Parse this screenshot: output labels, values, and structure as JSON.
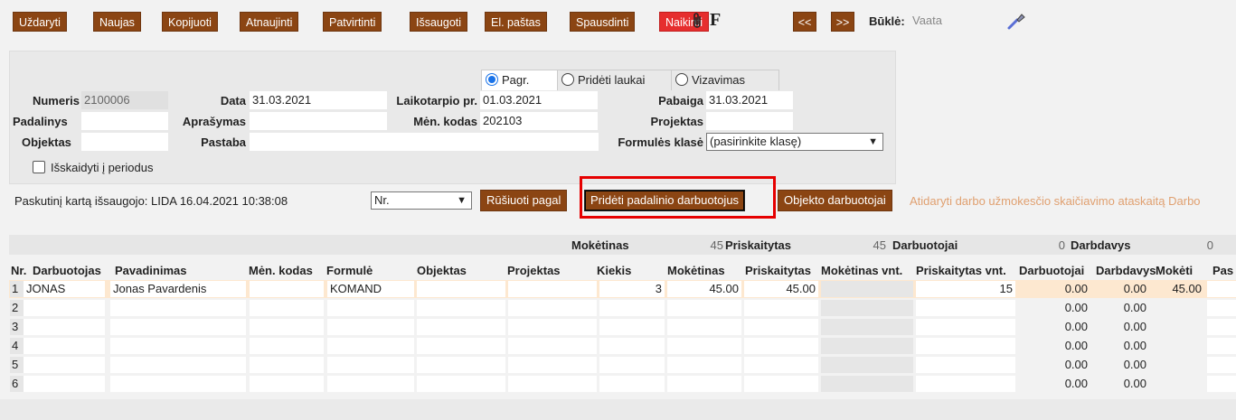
{
  "toolbar": {
    "buttons": [
      "Uždaryti",
      "Naujas",
      "Kopijuoti",
      "Atnaujinti",
      "Patvirtinti",
      "Išsaugoti",
      "El. paštas",
      "Spausdinti",
      "Naikinti"
    ],
    "prev": "<<",
    "next": ">>",
    "f_label": "F",
    "status_label": "Būklė:",
    "status_value": "Vaata"
  },
  "tabs": [
    "Pagr.",
    "Pridėti laukai",
    "Vizavimas"
  ],
  "form": {
    "numeris_label": "Numeris",
    "numeris": "2100006",
    "data_label": "Data",
    "data": "31.03.2021",
    "laikotarpio_label": "Laikotarpio pr.",
    "laikotarpio": "01.03.2021",
    "pabaiga_label": "Pabaiga",
    "pabaiga": "31.03.2021",
    "padalinys_label": "Padalinys",
    "padalinys": "",
    "aprasymas_label": "Aprašymas",
    "aprasymas": "",
    "men_kodas_label": "Mėn. kodas",
    "men_kodas": "202103",
    "projektas_label": "Projektas",
    "projektas": "",
    "objektas_label": "Objektas",
    "objektas": "",
    "pastaba_label": "Pastaba",
    "pastaba": "",
    "formules_klase_label": "Formulės klasė",
    "formules_klase": "(pasirinkite klasę)",
    "isskaidyti_label": "Išskaidyti į periodus"
  },
  "actions": {
    "last_saved": "Paskutinį kartą išsaugojo: LIDA 16.04.2021 10:38:08",
    "sort_select": "Nr.",
    "sort_button": "Rūšiuoti pagal",
    "add_unit_employees": "Pridėti padalinio darbuotojus",
    "object_employees": "Objekto darbuotojai",
    "open_report": "Atidaryti darbo užmokesčio skaičiavimo ataskaitą Darbo"
  },
  "summary": {
    "moketinas_label": "Mokėtinas",
    "moketinas": "45",
    "priskaitytas_label": "Priskaitytas",
    "priskaitytas": "45",
    "darbuotojai_label": "Darbuotojai",
    "darbuotojai": "0",
    "darbdavys_label": "Darbdavys",
    "darbdavys": "0"
  },
  "table": {
    "headers": [
      "Nr.",
      "Darbuotojas",
      "Pavadinimas",
      "Mėn. kodas",
      "Formulė",
      "Objektas",
      "Projektas",
      "Kiekis",
      "Mokėtinas",
      "Priskaitytas",
      "Mokėtinas vnt.",
      "Priskaitytas vnt.",
      "Darbuotojai",
      "Darbdavys",
      "Mokėti",
      "Pas"
    ],
    "rows": [
      {
        "nr": "1",
        "darbuotojas": "JONAS",
        "pavadinimas": "Jonas Pavardenis",
        "men_kodas": "",
        "formule": "KOMAND",
        "objektas": "",
        "projektas": "",
        "kiekis": "3",
        "moketinas": "45.00",
        "priskaitytas": "45.00",
        "moketinas_vnt": "",
        "priskaitytas_vnt": "15",
        "darbuotojai": "0.00",
        "darbdavys": "0.00",
        "moketi": "45.00"
      },
      {
        "nr": "2",
        "darbuotojas": "",
        "pavadinimas": "",
        "men_kodas": "",
        "formule": "",
        "objektas": "",
        "projektas": "",
        "kiekis": "",
        "moketinas": "",
        "priskaitytas": "",
        "moketinas_vnt": "",
        "priskaitytas_vnt": "",
        "darbuotojai": "0.00",
        "darbdavys": "0.00",
        "moketi": ""
      },
      {
        "nr": "3",
        "darbuotojas": "",
        "pavadinimas": "",
        "men_kodas": "",
        "formule": "",
        "objektas": "",
        "projektas": "",
        "kiekis": "",
        "moketinas": "",
        "priskaitytas": "",
        "moketinas_vnt": "",
        "priskaitytas_vnt": "",
        "darbuotojai": "0.00",
        "darbdavys": "0.00",
        "moketi": ""
      },
      {
        "nr": "4",
        "darbuotojas": "",
        "pavadinimas": "",
        "men_kodas": "",
        "formule": "",
        "objektas": "",
        "projektas": "",
        "kiekis": "",
        "moketinas": "",
        "priskaitytas": "",
        "moketinas_vnt": "",
        "priskaitytas_vnt": "",
        "darbuotojai": "0.00",
        "darbdavys": "0.00",
        "moketi": ""
      },
      {
        "nr": "5",
        "darbuotojas": "",
        "pavadinimas": "",
        "men_kodas": "",
        "formule": "",
        "objektas": "",
        "projektas": "",
        "kiekis": "",
        "moketinas": "",
        "priskaitytas": "",
        "moketinas_vnt": "",
        "priskaitytas_vnt": "",
        "darbuotojai": "0.00",
        "darbdavys": "0.00",
        "moketi": ""
      },
      {
        "nr": "6",
        "darbuotojas": "",
        "pavadinimas": "",
        "men_kodas": "",
        "formule": "",
        "objektas": "",
        "projektas": "",
        "kiekis": "",
        "moketinas": "",
        "priskaitytas": "",
        "moketinas_vnt": "",
        "priskaitytas_vnt": "",
        "darbuotojai": "0.00",
        "darbdavys": "0.00",
        "moketi": ""
      }
    ]
  }
}
